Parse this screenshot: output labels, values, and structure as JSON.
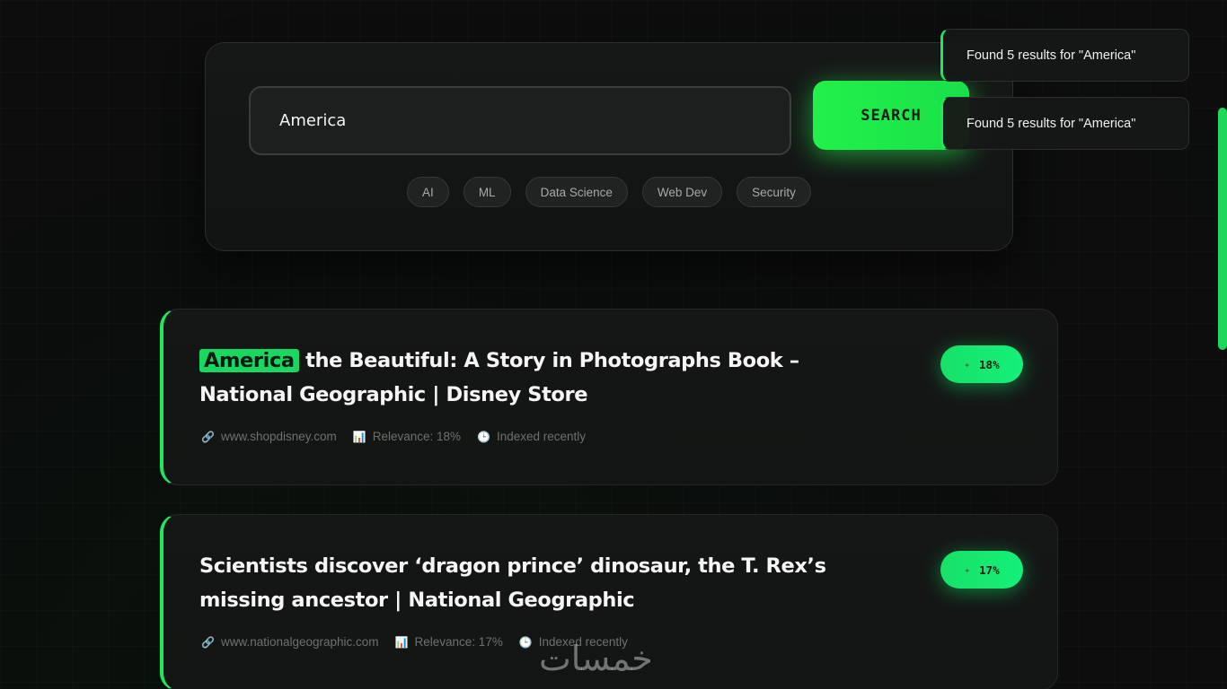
{
  "search": {
    "value": "America",
    "button_label": "SEARCH",
    "tags": [
      "AI",
      "ML",
      "Data Science",
      "Web Dev",
      "Security"
    ]
  },
  "toasts": [
    "Found 5 results for \"America\"",
    "Found 5 results for \"America\""
  ],
  "results": [
    {
      "highlight": "America",
      "title_rest": " the Beautiful: A Story in Photographs Book – National Geographic | Disney Store",
      "url": "www.shopdisney.com",
      "relevance": "Relevance: 18%",
      "indexed": "Indexed recently",
      "badge": "18%"
    },
    {
      "highlight": "",
      "title_rest": "Scientists discover ‘dragon prince’ dinosaur, the T. Rex’s missing ancestor | National Geographic",
      "url": "www.nationalgeographic.com",
      "relevance": "Relevance: 17%",
      "indexed": "Indexed recently",
      "badge": "17%"
    }
  ],
  "watermark": "خمسات",
  "colors": {
    "accent": "#1ee860",
    "background": "#0d0d0d",
    "card": "#151716"
  },
  "icons": {
    "url": "link-icon",
    "relevance": "chart-icon",
    "indexed": "clock-icon",
    "badge": "sparkle-icon"
  }
}
